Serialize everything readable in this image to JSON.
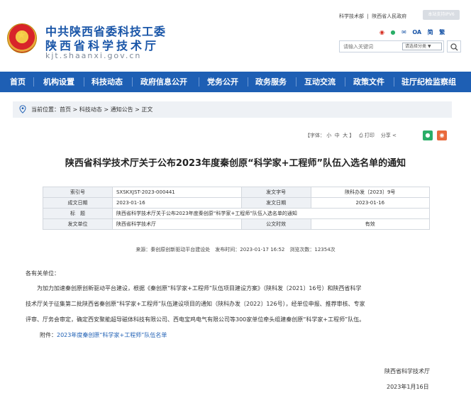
{
  "header": {
    "org_line1": "中共陕西省委科技工委",
    "org_line2": "陕西省科学技术厅",
    "domain": "kjt.shaanxi.gov.cn",
    "top_links": [
      "科学技术部",
      "陕西省人民政府"
    ],
    "mobile_label": "本站支持IPV6",
    "icons": [
      "weibo-icon",
      "wechat-icon",
      "mail-icon",
      "oa-icon",
      "traditional-chinese-icon",
      "accessibility-icon"
    ],
    "icon_text": {
      "oa": "OA",
      "fan": "简",
      "acc": "繁"
    },
    "search_placeholder": "请输入关键词",
    "search_scope": "请选择分类"
  },
  "nav": {
    "items": [
      "首页",
      "机构设置",
      "科技动态",
      "政府信息公开",
      "党务公开",
      "政务服务",
      "互动交流",
      "政策文件",
      "驻厅纪检监察组"
    ]
  },
  "breadcrumb": {
    "label": "当前位置：",
    "path": "首页 > 科技动态 > 通知公告 > 正文"
  },
  "tools": {
    "font_label": "【字体：",
    "font_small": "小",
    "font_medium": "中",
    "font_large": "大",
    "font_end": "】",
    "print": "打印",
    "share": "分享"
  },
  "article": {
    "title": "陕西省科学技术厅关于公布2023年度秦创原“科学家+工程师”队伍入选名单的通知",
    "meta": {
      "index_label": "索引号",
      "index_value": "SXSKXJST-2023-000441",
      "doc_no_label": "发文字号",
      "doc_no_value": "陕科办发〔2023〕9号",
      "created_label": "成文日期",
      "created_value": "2023-01-16",
      "published_label": "发文日期",
      "published_value": "2023-01-16",
      "title_label": "标　题",
      "title_value": "陕西省科学技术厅关于公布2023年度秦创原“科学家+工程师”队伍入选名单的通知",
      "issuer_label": "发文单位",
      "issuer_value": "陕西省科学技术厅",
      "validity_label": "公文时效",
      "validity_value": "有效"
    },
    "source_line": "来源：秦创原创新驱动平台建设处　发布时间：2023-01-17 16:52　浏览次数：12354次",
    "salutation": "各有关单位：",
    "body_lines": [
      "为加力加速秦创原创新驱动平台建设，根据《秦创原“科学家+工程师”队伍项目建设方案》（陕科发〔2021〕16号）和陕西省科学",
      "技术厅关于征集第二批陕西省秦创原“科学家+工程师”队伍建设项目的通知（陕科办发〔2022〕126号），经单位申报、推荐审核、专家",
      "评审、厅务会审定，确定西安聚能超导磁体科技有限公司、西电宝鸡电气有限公司等300家单位牵头组建秦创原“科学家+工程师”队伍。"
    ],
    "attachment_label": "附件：",
    "attachment_link": "2023年度秦创原“科学家+工程师”队伍名单",
    "sign_org": "陕西省科学技术厅",
    "sign_date": "2023年1月16日"
  },
  "colors": {
    "nav_bg": "#1e5fb4",
    "brand": "#1a56a8",
    "link": "#1e5fb4"
  }
}
